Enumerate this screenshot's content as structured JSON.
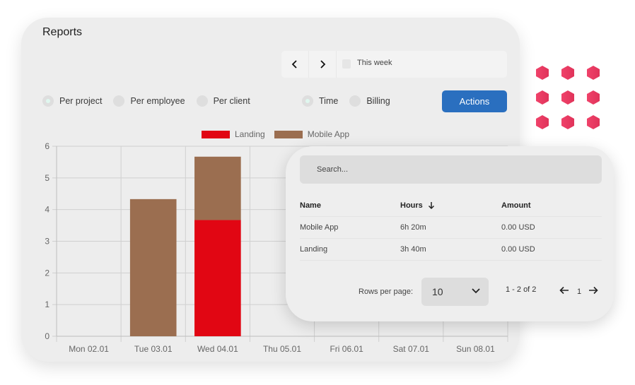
{
  "header": {
    "title": "Reports"
  },
  "date_range": {
    "prev_icon": "chevron-left-icon",
    "next_icon": "chevron-right-icon",
    "calendar_icon": "calendar-icon",
    "label": "This week"
  },
  "grouping": [
    {
      "label": "Per project",
      "checked": true
    },
    {
      "label": "Per employee",
      "checked": false
    },
    {
      "label": "Per client",
      "checked": false
    }
  ],
  "mode": [
    {
      "label": "Time",
      "checked": true
    },
    {
      "label": "Billing",
      "checked": false
    }
  ],
  "actions_label": "Actions",
  "colors": {
    "accent": "#2a6fbf",
    "landing": "#e10613",
    "mobile_app": "#9b6e50",
    "hex": "#e0335a"
  },
  "chart_data": {
    "type": "bar",
    "stacked": true,
    "categories": [
      "Mon 02.01",
      "Tue 03.01",
      "Wed 04.01",
      "Thu 05.01",
      "Fri 06.01",
      "Sat 07.01",
      "Sun 08.01"
    ],
    "series": [
      {
        "name": "Landing",
        "color": "#e10613",
        "values": [
          0,
          0,
          3.67,
          0,
          0,
          0,
          0
        ]
      },
      {
        "name": "Mobile App",
        "color": "#9b6e50",
        "values": [
          0,
          4.33,
          2.0,
          0,
          0,
          0,
          0
        ]
      }
    ],
    "yticks": [
      0,
      1,
      2,
      3,
      4,
      5,
      6
    ],
    "ylim": [
      0,
      6
    ],
    "xlabel": "",
    "ylabel": "",
    "grid": true,
    "legend": "top-center"
  },
  "table": {
    "search_placeholder": "Search...",
    "columns": [
      {
        "label": "Name"
      },
      {
        "label": "Hours",
        "sort_icon": "arrow-down-icon"
      },
      {
        "label": "Amount"
      }
    ],
    "rows": [
      {
        "name": "Mobile App",
        "hours": "6h 20m",
        "amount": "0.00 USD"
      },
      {
        "name": "Landing",
        "hours": "3h 40m",
        "amount": "0.00 USD"
      }
    ],
    "rows_per_page_label": "Rows per page:",
    "rows_per_page": "10",
    "page_range": "1 - 2 of 2",
    "page": "1"
  }
}
